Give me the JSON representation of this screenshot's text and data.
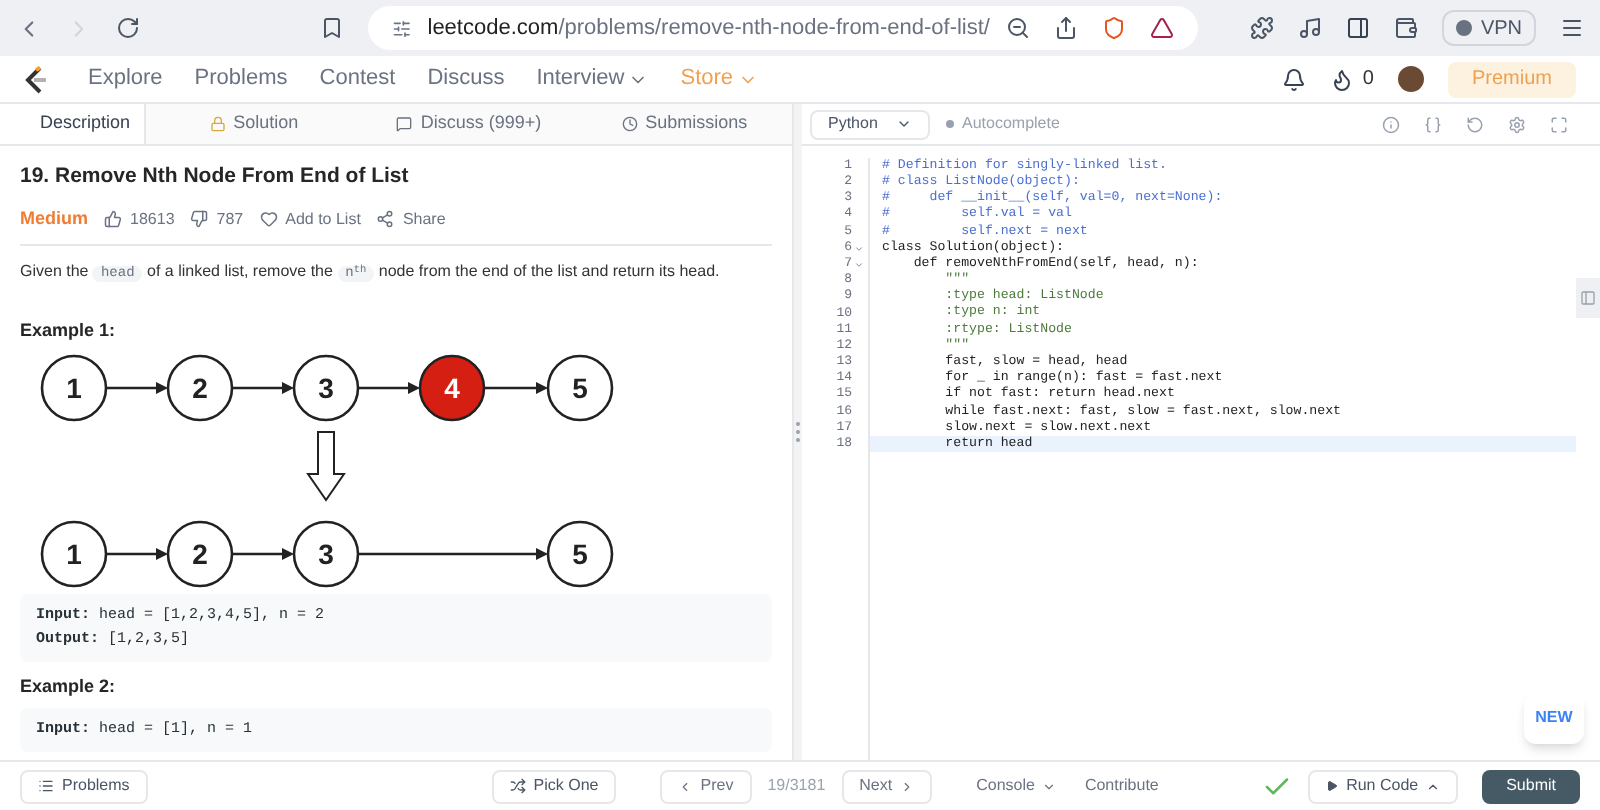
{
  "browser": {
    "url_host": "leetcode.com",
    "url_path": "/problems/remove-nth-node-from-end-of-list/",
    "vpn": "VPN"
  },
  "nav": {
    "items": [
      {
        "label": "Explore",
        "dropdown": false,
        "highlight": false
      },
      {
        "label": "Problems",
        "dropdown": false,
        "highlight": false
      },
      {
        "label": "Contest",
        "dropdown": false,
        "highlight": false
      },
      {
        "label": "Discuss",
        "dropdown": false,
        "highlight": false
      },
      {
        "label": "Interview",
        "dropdown": true,
        "highlight": false
      },
      {
        "label": "Store",
        "dropdown": true,
        "highlight": true
      }
    ],
    "coins": "0",
    "premium": "Premium"
  },
  "tabs": [
    {
      "label": "Description",
      "kind": "description",
      "selected": true
    },
    {
      "label": "Solution",
      "kind": "solution",
      "selected": false
    },
    {
      "label": "Discuss (999+)",
      "kind": "discuss",
      "selected": false
    },
    {
      "label": "Submissions",
      "kind": "submissions",
      "selected": false
    }
  ],
  "problem": {
    "title": "19. Remove Nth Node From End of List",
    "difficulty": "Medium",
    "likes": "18613",
    "dislikes": "787",
    "add_to_list": "Add to List",
    "share": "Share",
    "description": [
      {
        "kind": "text",
        "text": "Given the "
      },
      {
        "kind": "code",
        "text": "head"
      },
      {
        "kind": "text",
        "text": " of a linked list, remove the "
      },
      {
        "kind": "code",
        "text": "n$^{th}$"
      },
      {
        "kind": "text",
        "text": " node from the end of the list and return its head."
      }
    ],
    "examples": [
      {
        "title": "Example 1:",
        "diagram": {
          "before": [
            {
              "kind": "node",
              "label": "1",
              "removed": false
            },
            {
              "kind": "node",
              "label": "2",
              "removed": false
            },
            {
              "kind": "node",
              "label": "3",
              "removed": false
            },
            {
              "kind": "node",
              "label": "4",
              "removed": true
            },
            {
              "kind": "node",
              "label": "5",
              "removed": false
            }
          ],
          "after": [
            {
              "kind": "node",
              "label": "1",
              "removed": false
            },
            {
              "kind": "node",
              "label": "2",
              "removed": false
            },
            {
              "kind": "node",
              "label": "3",
              "removed": false
            },
            {
              "kind": "gap"
            },
            {
              "kind": "node",
              "label": "5",
              "removed": false
            }
          ]
        },
        "lines": [
          "**Input:** head = [1,2,3,4,5], n = 2",
          "**Output:** [1,2,3,5]"
        ]
      },
      {
        "title": "Example 2:",
        "lines": [
          "**Input:** head = [1], n = 1"
        ]
      }
    ]
  },
  "editor": {
    "language": "Python",
    "autocomplete": "Autocomplete",
    "lines": [
      {
        "number": "1",
        "kind": "comment",
        "text": "# Definition for singly-linked list.",
        "fold": false,
        "selected": false
      },
      {
        "number": "2",
        "kind": "comment",
        "text": "# class ListNode(object):",
        "fold": false,
        "selected": false
      },
      {
        "number": "3",
        "kind": "comment",
        "text": "#     def __init__(self, val=0, next=None):",
        "fold": false,
        "selected": false
      },
      {
        "number": "4",
        "kind": "comment",
        "text": "#         self.val = val",
        "fold": false,
        "selected": false
      },
      {
        "number": "5",
        "kind": "comment",
        "text": "#         self.next = next",
        "fold": false,
        "selected": false
      },
      {
        "number": "6",
        "kind": "code",
        "text": "class Solution(object):",
        "fold": true,
        "selected": false
      },
      {
        "number": "7",
        "kind": "code",
        "text": "    def removeNthFromEnd(self, head, n):",
        "fold": true,
        "selected": false
      },
      {
        "number": "8",
        "kind": "doc",
        "text": "        \"\"\"",
        "fold": false,
        "selected": false
      },
      {
        "number": "9",
        "kind": "doc",
        "text": "        :type head: ListNode",
        "fold": false,
        "selected": false
      },
      {
        "number": "10",
        "kind": "doc",
        "text": "        :type n: int",
        "fold": false,
        "selected": false
      },
      {
        "number": "11",
        "kind": "doc",
        "text": "        :rtype: ListNode",
        "fold": false,
        "selected": false
      },
      {
        "number": "12",
        "kind": "doc",
        "text": "        \"\"\"",
        "fold": false,
        "selected": false
      },
      {
        "number": "13",
        "kind": "code",
        "text": "        fast, slow = head, head",
        "fold": false,
        "selected": false
      },
      {
        "number": "14",
        "kind": "code",
        "text": "        for _ in range(n): fast = fast.next",
        "fold": false,
        "selected": false
      },
      {
        "number": "15",
        "kind": "code",
        "text": "        if not fast: return head.next",
        "fold": false,
        "selected": false
      },
      {
        "number": "16",
        "kind": "code",
        "text": "        while fast.next: fast, slow = fast.next, slow.next",
        "fold": false,
        "selected": false
      },
      {
        "number": "17",
        "kind": "code",
        "text": "        slow.next = slow.next.next",
        "fold": false,
        "selected": false
      },
      {
        "number": "18",
        "kind": "code",
        "text": "        return head",
        "fold": false,
        "selected": true
      }
    ],
    "new_badge": "NEW"
  },
  "footer": {
    "problems": "Problems",
    "pick_one": "Pick One",
    "prev": "Prev",
    "position": "19/3181",
    "next": "Next",
    "console": "Console",
    "contribute": "Contribute",
    "run_code": "Run Code",
    "submit": "Submit"
  }
}
